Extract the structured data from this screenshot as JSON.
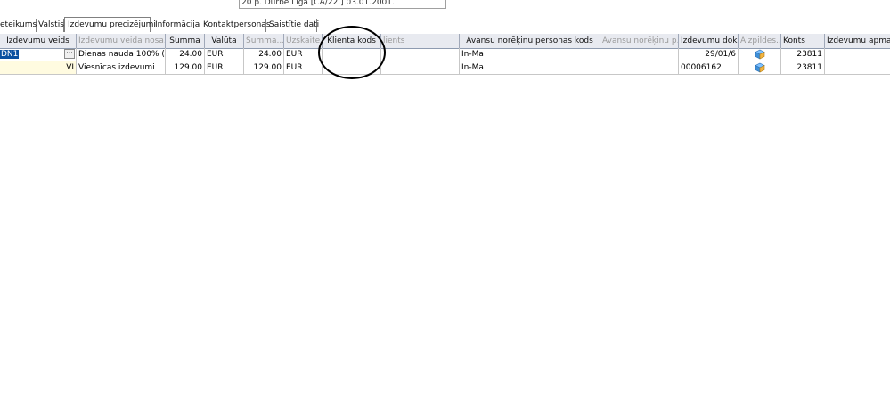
{
  "top_field": {
    "text": "20 p. Durbe Liga [CA/22.] 03.01.2001."
  },
  "tabs": [
    {
      "label": "eteikums"
    },
    {
      "label": "Valstis"
    },
    {
      "label": "Izdevumu precizējumi"
    },
    {
      "label": "Informācija"
    },
    {
      "label": "Kontaktpersonas"
    },
    {
      "label": "Saistītie dati"
    }
  ],
  "columns": [
    {
      "label": "Izdevumu veids"
    },
    {
      "label": "Izdevumu veida nosa..."
    },
    {
      "label": "Summa"
    },
    {
      "label": "Valūta"
    },
    {
      "label": "Summa..."
    },
    {
      "label": "Uzskaite..."
    },
    {
      "label": "Klienta kods"
    },
    {
      "label": "lients"
    },
    {
      "label": "Avansu norēķinu personas kods"
    },
    {
      "label": "Avansu norēķinu p..."
    },
    {
      "label": "Izdevumu dok..."
    },
    {
      "label": "Aizpildes..."
    },
    {
      "label": "Konts"
    },
    {
      "label": "Izdevumu apmaks"
    }
  ],
  "rows": [
    {
      "type": "DN1",
      "name": "Dienas nauda 100% (...",
      "sum": "24.00",
      "currency": "EUR",
      "sum2": "24.00",
      "acc_currency": "EUR",
      "client_code": "",
      "client": "",
      "adv_person_code": "In-Ma",
      "adv_person": "",
      "doc": "29/01/6",
      "fill_icon": "cube-icon",
      "account": "23811",
      "payment": ""
    },
    {
      "type": "VI",
      "name": "Viesnīcas izdevumi",
      "sum": "129.00",
      "currency": "EUR",
      "sum2": "129.00",
      "acc_currency": "EUR",
      "client_code": "",
      "client": "",
      "adv_person_code": "In-Ma",
      "adv_person": "",
      "doc": "00006162",
      "fill_icon": "cube-icon",
      "account": "23811",
      "payment": ""
    }
  ],
  "ellipsis_label": "···"
}
